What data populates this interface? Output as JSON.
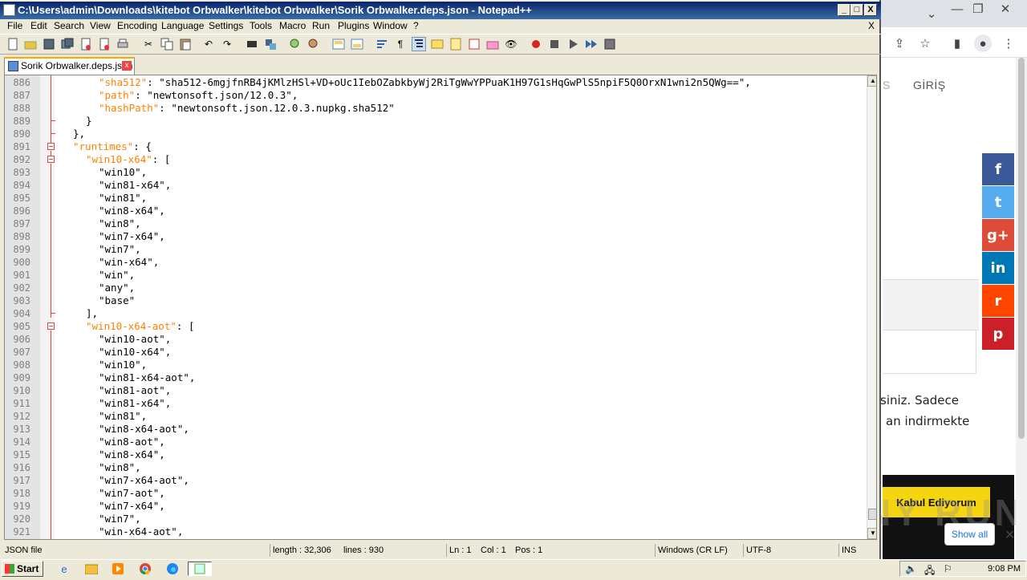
{
  "notepad": {
    "title": "C:\\Users\\admin\\Downloads\\kitebot Orbwalker\\kitebot Orbwalker\\Sorik Orbwalker.deps.json - Notepad++",
    "window_buttons": {
      "minimize": "_",
      "maximize": "□",
      "close": "X"
    },
    "menu": [
      "File",
      "Edit",
      "Search",
      "View",
      "Encoding",
      "Language",
      "Settings",
      "Tools",
      "Macro",
      "Run",
      "Plugins",
      "Window",
      "?"
    ],
    "menu_close": "X",
    "tab": {
      "label": "Sorik Orbwalker.deps.json",
      "close": "x"
    },
    "lines": [
      {
        "n": "886",
        "k": "\"sha512\"",
        "r": ": \"sha512-6mgjfnRB4jKMlzHSl+VD+oUc1IebOZabkbyWj2RiTgWwYPPuaK1H97G1sHqGwPlS5npiF5Q0OrxN1wni2n5QWg==\","
      },
      {
        "n": "887",
        "k": "\"path\"",
        "r": ": \"newtonsoft.json/12.0.3\","
      },
      {
        "n": "888",
        "k": "\"hashPath\"",
        "r": ": \"newtonsoft.json.12.0.3.nupkg.sha512\""
      },
      {
        "n": "889",
        "k": "",
        "r": "}"
      },
      {
        "n": "890",
        "k": "",
        "r": "},"
      },
      {
        "n": "891",
        "k": "\"runtimes\"",
        "r": ": {"
      },
      {
        "n": "892",
        "k": "\"win10-x64\"",
        "r": ": ["
      },
      {
        "n": "893",
        "k": "",
        "r": "\"win10\","
      },
      {
        "n": "894",
        "k": "",
        "r": "\"win81-x64\","
      },
      {
        "n": "895",
        "k": "",
        "r": "\"win81\","
      },
      {
        "n": "896",
        "k": "",
        "r": "\"win8-x64\","
      },
      {
        "n": "897",
        "k": "",
        "r": "\"win8\","
      },
      {
        "n": "898",
        "k": "",
        "r": "\"win7-x64\","
      },
      {
        "n": "899",
        "k": "",
        "r": "\"win7\","
      },
      {
        "n": "900",
        "k": "",
        "r": "\"win-x64\","
      },
      {
        "n": "901",
        "k": "",
        "r": "\"win\","
      },
      {
        "n": "902",
        "k": "",
        "r": "\"any\","
      },
      {
        "n": "903",
        "k": "",
        "r": "\"base\""
      },
      {
        "n": "904",
        "k": "",
        "r": "],"
      },
      {
        "n": "905",
        "k": "\"win10-x64-aot\"",
        "r": ": ["
      },
      {
        "n": "906",
        "k": "",
        "r": "\"win10-aot\","
      },
      {
        "n": "907",
        "k": "",
        "r": "\"win10-x64\","
      },
      {
        "n": "908",
        "k": "",
        "r": "\"win10\","
      },
      {
        "n": "909",
        "k": "",
        "r": "\"win81-x64-aot\","
      },
      {
        "n": "910",
        "k": "",
        "r": "\"win81-aot\","
      },
      {
        "n": "911",
        "k": "",
        "r": "\"win81-x64\","
      },
      {
        "n": "912",
        "k": "",
        "r": "\"win81\","
      },
      {
        "n": "913",
        "k": "",
        "r": "\"win8-x64-aot\","
      },
      {
        "n": "914",
        "k": "",
        "r": "\"win8-aot\","
      },
      {
        "n": "915",
        "k": "",
        "r": "\"win8-x64\","
      },
      {
        "n": "916",
        "k": "",
        "r": "\"win8\","
      },
      {
        "n": "917",
        "k": "",
        "r": "\"win7-x64-aot\","
      },
      {
        "n": "918",
        "k": "",
        "r": "\"win7-aot\","
      },
      {
        "n": "919",
        "k": "",
        "r": "\"win7-x64\","
      },
      {
        "n": "920",
        "k": "",
        "r": "\"win7\","
      },
      {
        "n": "921",
        "k": "",
        "r": "\"win-x64-aot\","
      }
    ],
    "status": {
      "type": "JSON file",
      "length": "length : 32,306",
      "lines": "lines : 930",
      "ln": "Ln : 1",
      "col": "Col : 1",
      "pos": "Pos : 1",
      "eol": "Windows (CR LF)",
      "encoding": "UTF-8",
      "mode": "INS"
    },
    "colors": {
      "key": "#ff8000",
      "title_bar": "#0a246a"
    }
  },
  "browser": {
    "nav_partial": "S",
    "nav_link": "GİRİŞ",
    "text_line1": "siniz. Sadece",
    "text_line2": "an indirmekte",
    "accept_button": "Kabul Ediyorum",
    "show_all": "Show all",
    "download_close": "✕",
    "social": [
      {
        "name": "facebook",
        "glyph": "f",
        "color": "#3b5998"
      },
      {
        "name": "twitter",
        "glyph": "t",
        "color": "#55acee"
      },
      {
        "name": "google-plus",
        "glyph": "g+",
        "color": "#dd4b39"
      },
      {
        "name": "linkedin",
        "glyph": "in",
        "color": "#0077b5"
      },
      {
        "name": "reddit",
        "glyph": "r",
        "color": "#ff4500"
      },
      {
        "name": "pinterest",
        "glyph": "p",
        "color": "#cb2027"
      }
    ],
    "watermark": "ANY RUN"
  },
  "taskbar": {
    "start": "Start",
    "clock": "9:08 PM"
  }
}
